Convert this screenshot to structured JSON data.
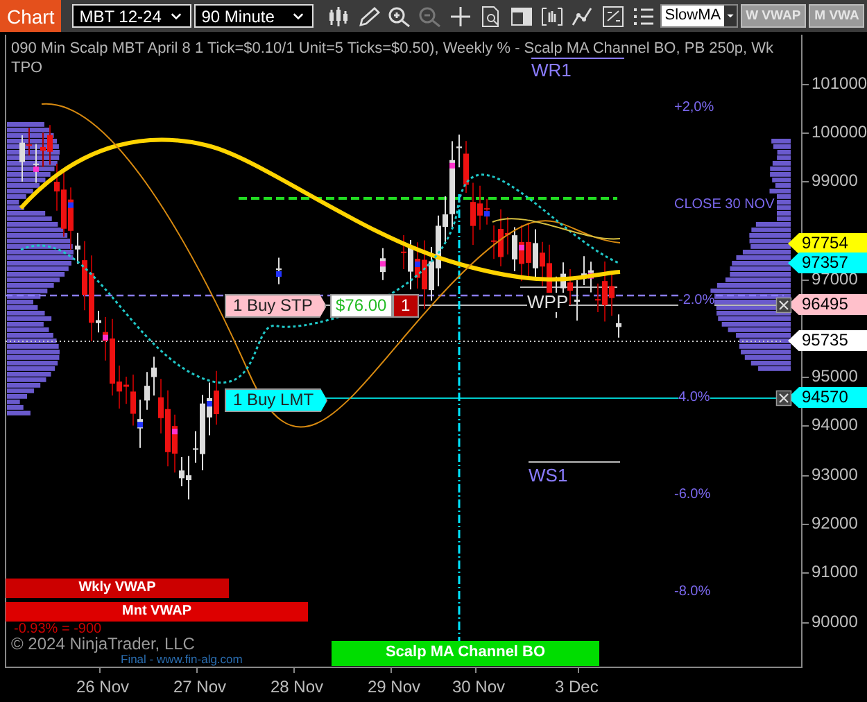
{
  "toolbar": {
    "tab": "Chart",
    "instrument": "MBT 12-24",
    "interval": "90 Minute",
    "indicator_select": "SlowMA",
    "buttons": [
      "W VWAP",
      "M VWA"
    ]
  },
  "chart": {
    "title_lines": [
      "090 Min Scalp MBT April 8 1 Tick=$0.10/1 Unit=5 Ticks=$0.50), Weekly % - Scalp MA Channel BO, PB 250p, Wk",
      "TPO"
    ],
    "pivot_labels": [
      "WR1",
      "WPP",
      "WS1"
    ],
    "percent_labels": [
      "+2,0%",
      "CLOSE 30 NOV",
      "-2.0%",
      "4.0%",
      "-6.0%",
      "-8.0%"
    ],
    "y_axis": [
      "101000",
      "100000",
      "99000",
      "97000",
      "95000",
      "94000",
      "93000",
      "92000",
      "91000",
      "90000"
    ],
    "price_labels": [
      {
        "text": "97754",
        "color": "#ffff00"
      },
      {
        "text": "97357",
        "color": "#00ffff"
      },
      {
        "text": "96495",
        "color": "#ffc0cb"
      },
      {
        "text": "95735",
        "color": "#ffffff"
      },
      {
        "text": "94570",
        "color": "#00ffff"
      }
    ],
    "orders": [
      {
        "label": "1 Buy STP",
        "color": "#ffc0cb",
        "pnl": "$76.00",
        "quantity": "1"
      },
      {
        "label": "1 Buy LMT",
        "color": "#00ffff"
      }
    ],
    "vwap_bars": [
      "Wkly VWAP",
      "Mnt VWAP"
    ],
    "pnl_text": "-0.93% = -900",
    "copyright": "© 2024 NinjaTrader, LLC",
    "footer_link": "Final - www.fin-alg.com",
    "strategy_banner": "Scalp MA Channel BO",
    "x_axis": [
      "26 Nov",
      "27 Nov",
      "28 Nov",
      "29 Nov",
      "30 Nov",
      "3 Dec"
    ]
  }
}
